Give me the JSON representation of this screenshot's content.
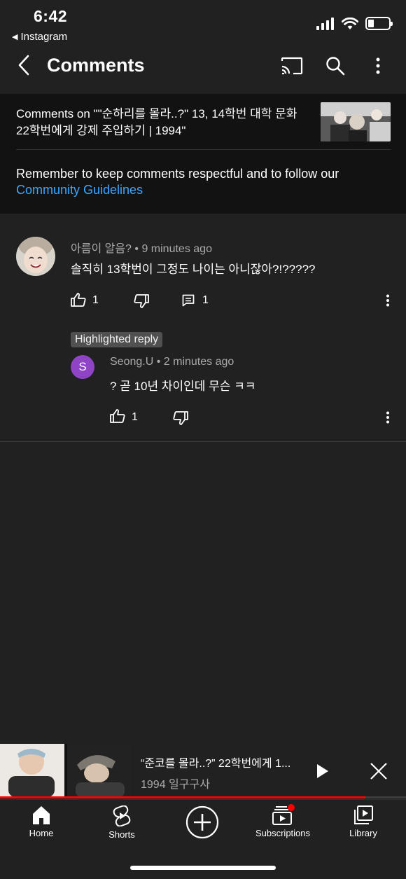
{
  "status_bar": {
    "time": "6:42",
    "back_app": "Instagram"
  },
  "header": {
    "title": "Comments",
    "icons": [
      "back-icon",
      "cast-icon",
      "search-icon",
      "more-vertical-icon"
    ]
  },
  "info": {
    "video_title": "Comments on \"\"순하리를 몰라..?\" 13, 14학번 대학 문화 22학번에게 강제 주입하기 | 1994\"",
    "guidelines_text": "Remember to keep comments respectful and to follow our",
    "guidelines_link": "Community Guidelines"
  },
  "comments": [
    {
      "author": "아름이 알음?",
      "time": "9 minutes ago",
      "text": "솔직히 13학번이 그정도 나이는 아니잖아?!?????",
      "likes": "1",
      "replies": "1"
    }
  ],
  "highlighted_reply": {
    "chip": "Highlighted reply",
    "avatar_letter": "S",
    "author": "Seong.U",
    "time": "2 minutes ago",
    "text": "? 곧 10년 차이인데 무슨 ㅋㅋ",
    "likes": "1"
  },
  "mini_player": {
    "title": "“준코를 몰라..?” 22학번에게 1...",
    "channel": "1994 일구구사",
    "progress": 0.9
  },
  "colors": {
    "background": "#212121",
    "panel": "#121212",
    "link": "#3ea6ff",
    "accent_red": "#ff0000",
    "reply_avatar": "#8e44c4"
  },
  "nav": [
    {
      "label": "Home",
      "icon": "home-icon"
    },
    {
      "label": "Shorts",
      "icon": "shorts-icon"
    },
    {
      "label": "",
      "icon": "create-icon"
    },
    {
      "label": "Subscriptions",
      "icon": "subscriptions-icon"
    },
    {
      "label": "Library",
      "icon": "library-icon"
    }
  ]
}
